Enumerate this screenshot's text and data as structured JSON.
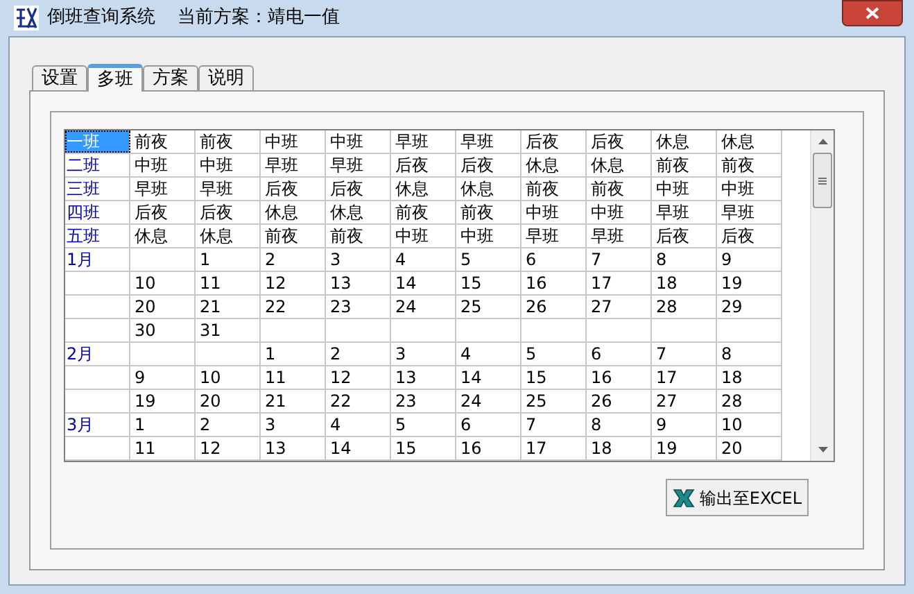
{
  "window": {
    "title": "倒班查询系统",
    "scheme_label": "当前方案：",
    "scheme": "靖电一值"
  },
  "tabs": [
    {
      "label": "设置",
      "selected": false
    },
    {
      "label": "多班",
      "selected": true
    },
    {
      "label": "方案",
      "selected": false
    },
    {
      "label": "说明",
      "selected": false
    }
  ],
  "grid": {
    "rows": [
      {
        "label": "一班",
        "selected": true,
        "cells": [
          "前夜",
          "前夜",
          "中班",
          "中班",
          "早班",
          "早班",
          "后夜",
          "后夜",
          "休息",
          "休息"
        ]
      },
      {
        "label": "二班",
        "selected": false,
        "cells": [
          "中班",
          "中班",
          "早班",
          "早班",
          "后夜",
          "后夜",
          "休息",
          "休息",
          "前夜",
          "前夜"
        ]
      },
      {
        "label": "三班",
        "selected": false,
        "cells": [
          "早班",
          "早班",
          "后夜",
          "后夜",
          "休息",
          "休息",
          "前夜",
          "前夜",
          "中班",
          "中班"
        ]
      },
      {
        "label": "四班",
        "selected": false,
        "cells": [
          "后夜",
          "后夜",
          "休息",
          "休息",
          "前夜",
          "前夜",
          "中班",
          "中班",
          "早班",
          "早班"
        ]
      },
      {
        "label": "五班",
        "selected": false,
        "cells": [
          "休息",
          "休息",
          "前夜",
          "前夜",
          "中班",
          "中班",
          "早班",
          "早班",
          "后夜",
          "后夜"
        ]
      },
      {
        "label": "1月",
        "selected": false,
        "cells": [
          null,
          "1",
          "2",
          "3",
          "4",
          "5",
          "6",
          "7",
          "8",
          "9"
        ]
      },
      {
        "label": null,
        "selected": false,
        "cells": [
          "10",
          "11",
          "12",
          "13",
          "14",
          "15",
          "16",
          "17",
          "18",
          "19"
        ]
      },
      {
        "label": null,
        "selected": false,
        "cells": [
          "20",
          "21",
          "22",
          "23",
          "24",
          "25",
          "26",
          "27",
          "28",
          "29"
        ]
      },
      {
        "label": null,
        "selected": false,
        "cells": [
          "30",
          "31",
          null,
          null,
          null,
          null,
          null,
          null,
          null,
          null
        ]
      },
      {
        "label": "2月",
        "selected": false,
        "cells": [
          null,
          null,
          "1",
          "2",
          "3",
          "4",
          "5",
          "6",
          "7",
          "8"
        ]
      },
      {
        "label": null,
        "selected": false,
        "cells": [
          "9",
          "10",
          "11",
          "12",
          "13",
          "14",
          "15",
          "16",
          "17",
          "18"
        ]
      },
      {
        "label": null,
        "selected": false,
        "cells": [
          "19",
          "20",
          "21",
          "22",
          "23",
          "24",
          "25",
          "26",
          "27",
          "28"
        ]
      },
      {
        "label": "3月",
        "selected": false,
        "cells": [
          "1",
          "2",
          "3",
          "4",
          "5",
          "6",
          "7",
          "8",
          "9",
          "10"
        ]
      },
      {
        "label": null,
        "selected": false,
        "cells": [
          "11",
          "12",
          "13",
          "14",
          "15",
          "16",
          "17",
          "18",
          "19",
          "20"
        ]
      }
    ]
  },
  "export_button": {
    "label": "输出至EXCEL"
  }
}
